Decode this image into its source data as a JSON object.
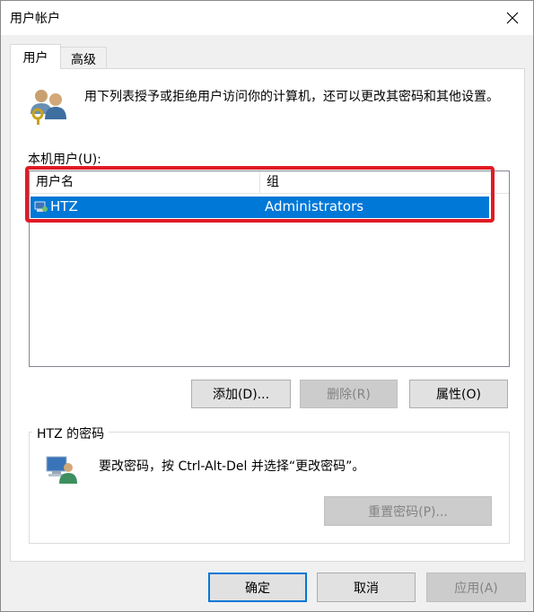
{
  "window": {
    "title": "用户帐户"
  },
  "tabs": [
    {
      "label": "用户"
    },
    {
      "label": "高级"
    }
  ],
  "intro_text": "用下列表授予或拒绝用户访问你的计算机，还可以更改其密码和其他设置。",
  "local_users_label": "本机用户(U):",
  "list": {
    "columns": [
      "用户名",
      "组"
    ],
    "rows": [
      {
        "name": "HTZ",
        "group": "Administrators",
        "selected": true
      }
    ]
  },
  "buttons": {
    "add": "添加(D)...",
    "remove": "删除(R)",
    "properties": "属性(O)"
  },
  "password_section": {
    "legend": "HTZ 的密码",
    "text": "要改密码，按 Ctrl-Alt-Del 并选择“更改密码”。",
    "reset_button": "重置密码(P)..."
  },
  "dialog_buttons": {
    "ok": "确定",
    "cancel": "取消",
    "apply": "应用(A)"
  },
  "colors": {
    "selection": "#0078d7",
    "highlight_box": "#e01b24"
  }
}
